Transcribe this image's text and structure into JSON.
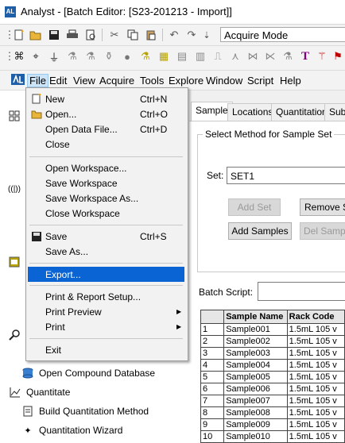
{
  "window": {
    "app_icon": "AL",
    "title": "Analyst - [Batch Editor: [S23-201213 - Import]]"
  },
  "toolbar": {
    "mode_value": "Acquire Mode"
  },
  "menubar": {
    "items": [
      "File",
      "Edit",
      "View",
      "Acquire",
      "Tools",
      "Explore",
      "Window",
      "Script",
      "Help"
    ]
  },
  "file_menu": {
    "items": [
      {
        "label": "New",
        "shortcut": "Ctrl+N",
        "icon": "new-doc-icon"
      },
      {
        "label": "Open...",
        "shortcut": "Ctrl+O",
        "icon": "open-folder-icon"
      },
      {
        "label": "Open Data File...",
        "shortcut": "Ctrl+D"
      },
      {
        "label": "Close",
        "shortcut": ""
      },
      {
        "label": "Open Workspace...",
        "shortcut": ""
      },
      {
        "label": "Save Workspace",
        "shortcut": ""
      },
      {
        "label": "Save Workspace As...",
        "shortcut": ""
      },
      {
        "label": "Close Workspace",
        "shortcut": ""
      },
      {
        "label": "Save",
        "shortcut": "Ctrl+S",
        "icon": "save-icon"
      },
      {
        "label": "Save As...",
        "shortcut": ""
      },
      {
        "label": "Export...",
        "shortcut": "",
        "highlighted": true
      },
      {
        "label": "Print & Report Setup...",
        "shortcut": ""
      },
      {
        "label": "Print Preview",
        "shortcut": "",
        "submenu": true
      },
      {
        "label": "Print",
        "shortcut": "",
        "submenu": true
      },
      {
        "label": "Exit",
        "shortcut": ""
      }
    ]
  },
  "left_panel": {
    "items": [
      {
        "label": "Open Compound Database",
        "icon": "database-icon"
      },
      {
        "label": "Quantitate",
        "icon": "quantitate-icon"
      },
      {
        "label": "Build Quantitation Method",
        "icon": "build-method-icon"
      },
      {
        "label": "Quantitation Wizard",
        "icon": "wizard-icon"
      }
    ]
  },
  "editor": {
    "tabs": [
      "Sample",
      "Locations",
      "Quantitation",
      "Subm"
    ],
    "group_title": "Select Method for Sample Set",
    "set_label": "Set:",
    "set_value": "SET1",
    "buttons": {
      "add_set": "Add Set",
      "remove_set": "Remove Set",
      "add_samples": "Add Samples",
      "del_samples": "Del Samples"
    },
    "batch_script_label": "Batch Script:",
    "grid": {
      "columns": [
        "",
        "Sample Name",
        "Rack Code"
      ],
      "rows": [
        [
          "1",
          "Sample001",
          "1.5mL 105 v"
        ],
        [
          "2",
          "Sample002",
          "1.5mL 105 v"
        ],
        [
          "3",
          "Sample003",
          "1.5mL 105 v"
        ],
        [
          "4",
          "Sample004",
          "1.5mL 105 v"
        ],
        [
          "5",
          "Sample005",
          "1.5mL 105 v"
        ],
        [
          "6",
          "Sample006",
          "1.5mL 105 v"
        ],
        [
          "7",
          "Sample007",
          "1.5mL 105 v"
        ],
        [
          "8",
          "Sample008",
          "1.5mL 105 v"
        ],
        [
          "9",
          "Sample009",
          "1.5mL 105 v"
        ],
        [
          "10",
          "Sample010",
          "1.5mL 105 v"
        ]
      ]
    }
  }
}
